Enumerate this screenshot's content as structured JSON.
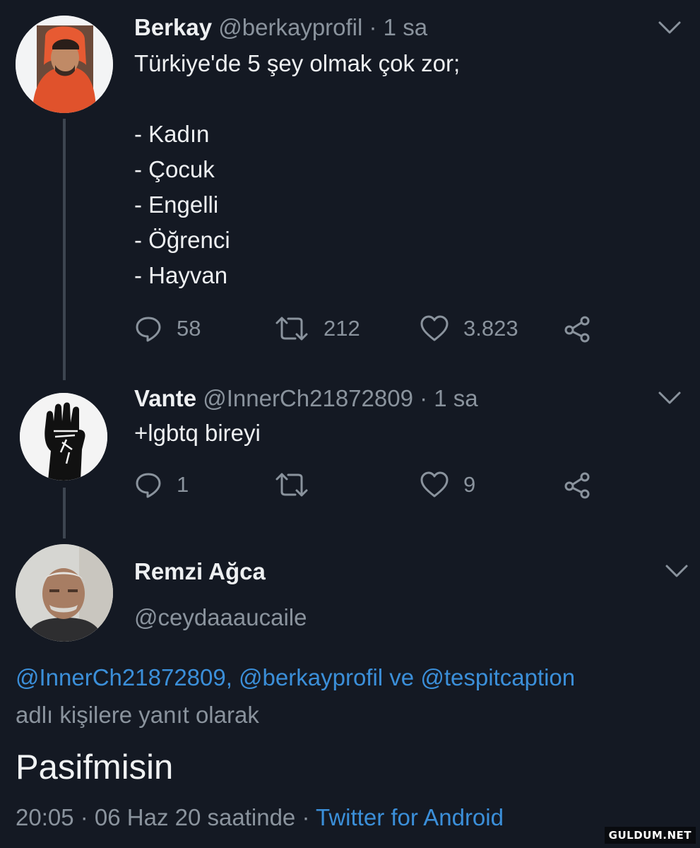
{
  "tweets": [
    {
      "name": "Berkay",
      "handle": "@berkayprofil",
      "time": "· 1 sa",
      "lines": [
        "Türkiye'de 5 şey olmak çok zor;",
        "",
        "- Kadın",
        "- Çocuk",
        "- Engelli",
        "- Öğrenci",
        "- Hayvan"
      ],
      "reply_count": "58",
      "retweet_count": "212",
      "like_count": "3.823"
    },
    {
      "name": "Vante",
      "handle": "@InnerCh21872809",
      "time": "· 1 sa",
      "text": "+lgbtq bireyi",
      "reply_count": "1",
      "retweet_count": "",
      "like_count": "9"
    }
  ],
  "main_tweet": {
    "name": "Remzi Ağca",
    "handle": "@ceydaaaucaile",
    "mentions": "@InnerCh21872809, @berkayprofil ve @tespitcaption",
    "reply_context": "adlı kişilere yanıt olarak",
    "text": "Pasifmisin",
    "timestamp": "20:05 · 06 Haz 20 saatinde ·",
    "source": "Twitter for Android"
  },
  "watermark": "GULDUM.NET",
  "icons": [
    "reply-icon",
    "retweet-icon",
    "like-icon",
    "share-icon",
    "chevron-down-icon"
  ],
  "colors": {
    "background": "#141923",
    "link": "#3b8fd9",
    "muted": "#8a939d"
  }
}
